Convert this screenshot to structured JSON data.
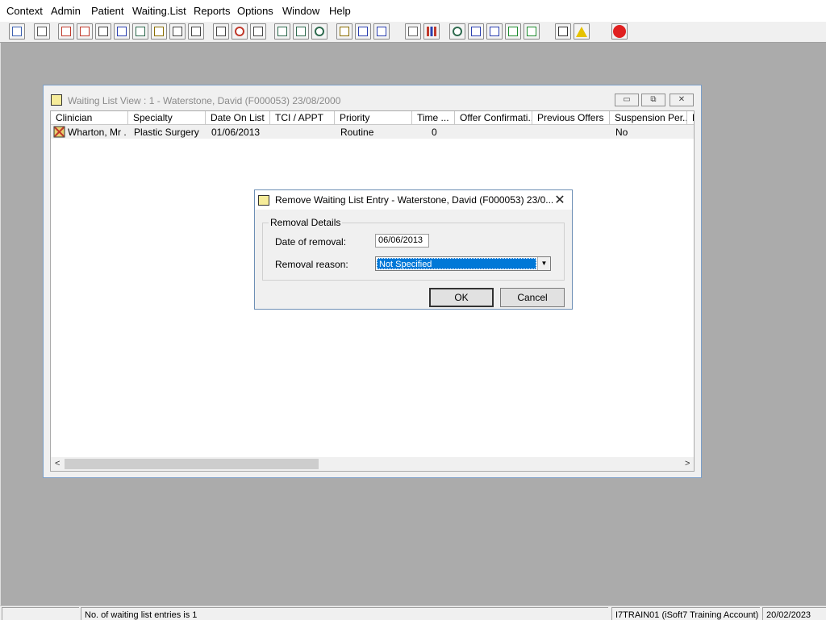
{
  "menu": [
    "Context",
    "Admin",
    "Patient",
    "Waiting.List",
    "Reports",
    "Options",
    "Window",
    "Help"
  ],
  "toolbar": {
    "buttons": [
      {
        "icon": "person-icon",
        "color": "#3b5fb0"
      },
      {
        "icon": "printer-icon",
        "color": "#555555"
      },
      {
        "icon": "book-icon",
        "color": "#c0392b"
      },
      {
        "icon": "edit-book-icon",
        "color": "#c0392b"
      },
      {
        "icon": "search-document-icon",
        "color": "#444444"
      },
      {
        "icon": "m-icon",
        "color": "#2a3fb0"
      },
      {
        "icon": "clinician-icon",
        "color": "#2f6b4f"
      },
      {
        "icon": "notes-icon",
        "color": "#8a6d00"
      },
      {
        "icon": "arrow-form-icon",
        "color": "#444444"
      },
      {
        "icon": "arrow-form-2-icon",
        "color": "#444444"
      },
      {
        "icon": "search-icon",
        "color": "#444444"
      },
      {
        "icon": "clock-icon",
        "color": "#c0392b"
      },
      {
        "icon": "list-icon",
        "color": "#444444"
      },
      {
        "icon": "person-card-icon",
        "color": "#2f6b4f"
      },
      {
        "icon": "card-icon",
        "color": "#2f6b4f"
      },
      {
        "icon": "alarm-clock-icon",
        "color": "#2f6b4f"
      },
      {
        "icon": "waiting-list-icon",
        "color": "#8a6d00"
      },
      {
        "icon": "bed-icon",
        "color": "#2a3fb0"
      },
      {
        "icon": "people-icon",
        "color": "#2a3fb0"
      },
      {
        "icon": "page-icon",
        "color": "#666666"
      },
      {
        "icon": "bar-chart-icon",
        "color": "#c0392b"
      },
      {
        "icon": "globe-icon",
        "color": "#2f6b4f"
      },
      {
        "icon": "check-list-icon",
        "color": "#2a3fb0"
      },
      {
        "icon": "check-list-2-icon",
        "color": "#2a3fb0"
      },
      {
        "icon": "green-arrow-list-icon",
        "color": "#1e8c2f"
      },
      {
        "icon": "green-arrow-list-2-icon",
        "color": "#1e8c2f"
      },
      {
        "icon": "swap-icon",
        "color": "#333333"
      },
      {
        "icon": "warning-icon",
        "color": "#e6c200"
      },
      {
        "icon": "exit-icon",
        "color": "#e02020"
      }
    ]
  },
  "waiting_list_window": {
    "title": "Waiting List View :  1 - Waterstone, David (F000053) 23/08/2000",
    "controls": {
      "minimize": "▭",
      "restore": "⧉",
      "close": "✕"
    },
    "columns": [
      "Clinician",
      "Specialty",
      "Date On List",
      "TCI / APPT",
      "Priority",
      "Time ...",
      "Offer Confirmati...",
      "Previous Offers",
      "Suspension Per...",
      "R"
    ],
    "rows": [
      [
        "Wharton, Mr ...",
        "Plastic Surgery",
        "01/06/2013",
        "",
        "Routine",
        "0",
        "",
        "",
        "No"
      ]
    ],
    "scroll_left": "<",
    "scroll_right": ">"
  },
  "dialog": {
    "title": "Remove Waiting List Entry - Waterstone, David (F000053) 23/0...",
    "close": "✕",
    "group_label": "Removal Details",
    "date_label": "Date of removal:",
    "date_value": "06/06/2013",
    "reason_label": "Removal reason:",
    "reason_value": "Not Specified",
    "ok_label": "OK",
    "cancel_label": "Cancel"
  },
  "statusbar": {
    "blank": "",
    "message": "No. of waiting list entries is 1",
    "account": "I7TRAIN01 (iSoft7 Training Account)",
    "date": "20/02/2023"
  }
}
